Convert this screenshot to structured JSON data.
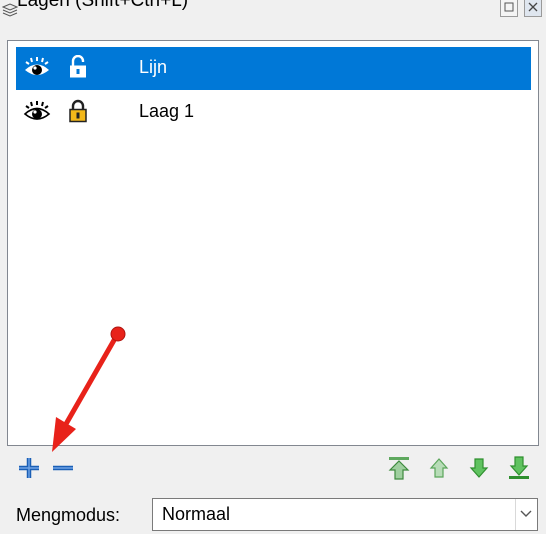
{
  "dialog": {
    "title": "Lagen (Shift+Ctrl+L)"
  },
  "layers": [
    {
      "name": "Lijn",
      "visible": true,
      "locked": false,
      "selected": true
    },
    {
      "name": "Laag 1",
      "visible": true,
      "locked": true,
      "selected": false
    }
  ],
  "toolbar": {
    "left": [
      "add-layer",
      "remove-layer"
    ],
    "right": [
      "raise-to-top",
      "raise",
      "lower",
      "lower-to-bottom"
    ]
  },
  "blend": {
    "label": "Mengmodus:",
    "value": "Normaal"
  },
  "colors": {
    "selection": "#0078d7",
    "annotation_arrow": "#e8221a",
    "add_icon": "#1b5fb5",
    "move_icons": "#3cab3c"
  }
}
